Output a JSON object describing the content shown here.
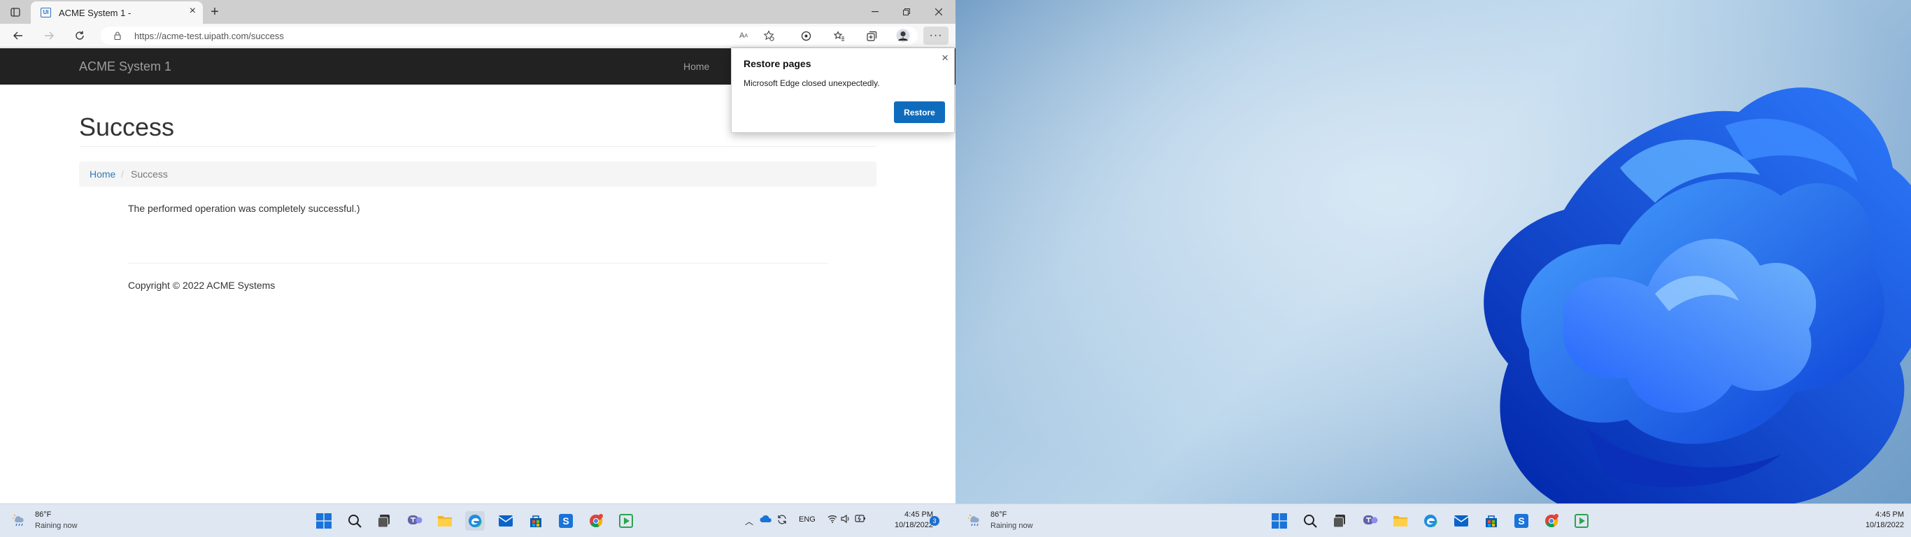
{
  "browser": {
    "tab_title": "ACME System 1 -",
    "url": "https://acme-test.uipath.com/success",
    "tab_favicon": "UI"
  },
  "site": {
    "brand": "ACME System 1",
    "nav_home": "Home",
    "page_title": "Success",
    "breadcrumb": {
      "home": "Home",
      "sep": "/",
      "current": "Success"
    },
    "message": "The performed operation was completely successful.)",
    "copyright": "Copyright © 2022 ACME Systems"
  },
  "popup": {
    "title": "Restore pages",
    "message": "Microsoft Edge closed unexpectedly.",
    "button": "Restore"
  },
  "taskbar": {
    "weather_temp": "86°F",
    "weather_cond": "Raining now",
    "language": "ENG",
    "time": "4:45 PM",
    "date": "10/18/2022",
    "notification_count": "3"
  },
  "taskbar2": {
    "weather_temp": "86°F",
    "weather_cond": "Raining now",
    "time": "4:45 PM",
    "date": "10/18/2022"
  },
  "colors": {
    "accent": "#0f6cbd",
    "navbar": "#222222",
    "link": "#337ab7"
  }
}
